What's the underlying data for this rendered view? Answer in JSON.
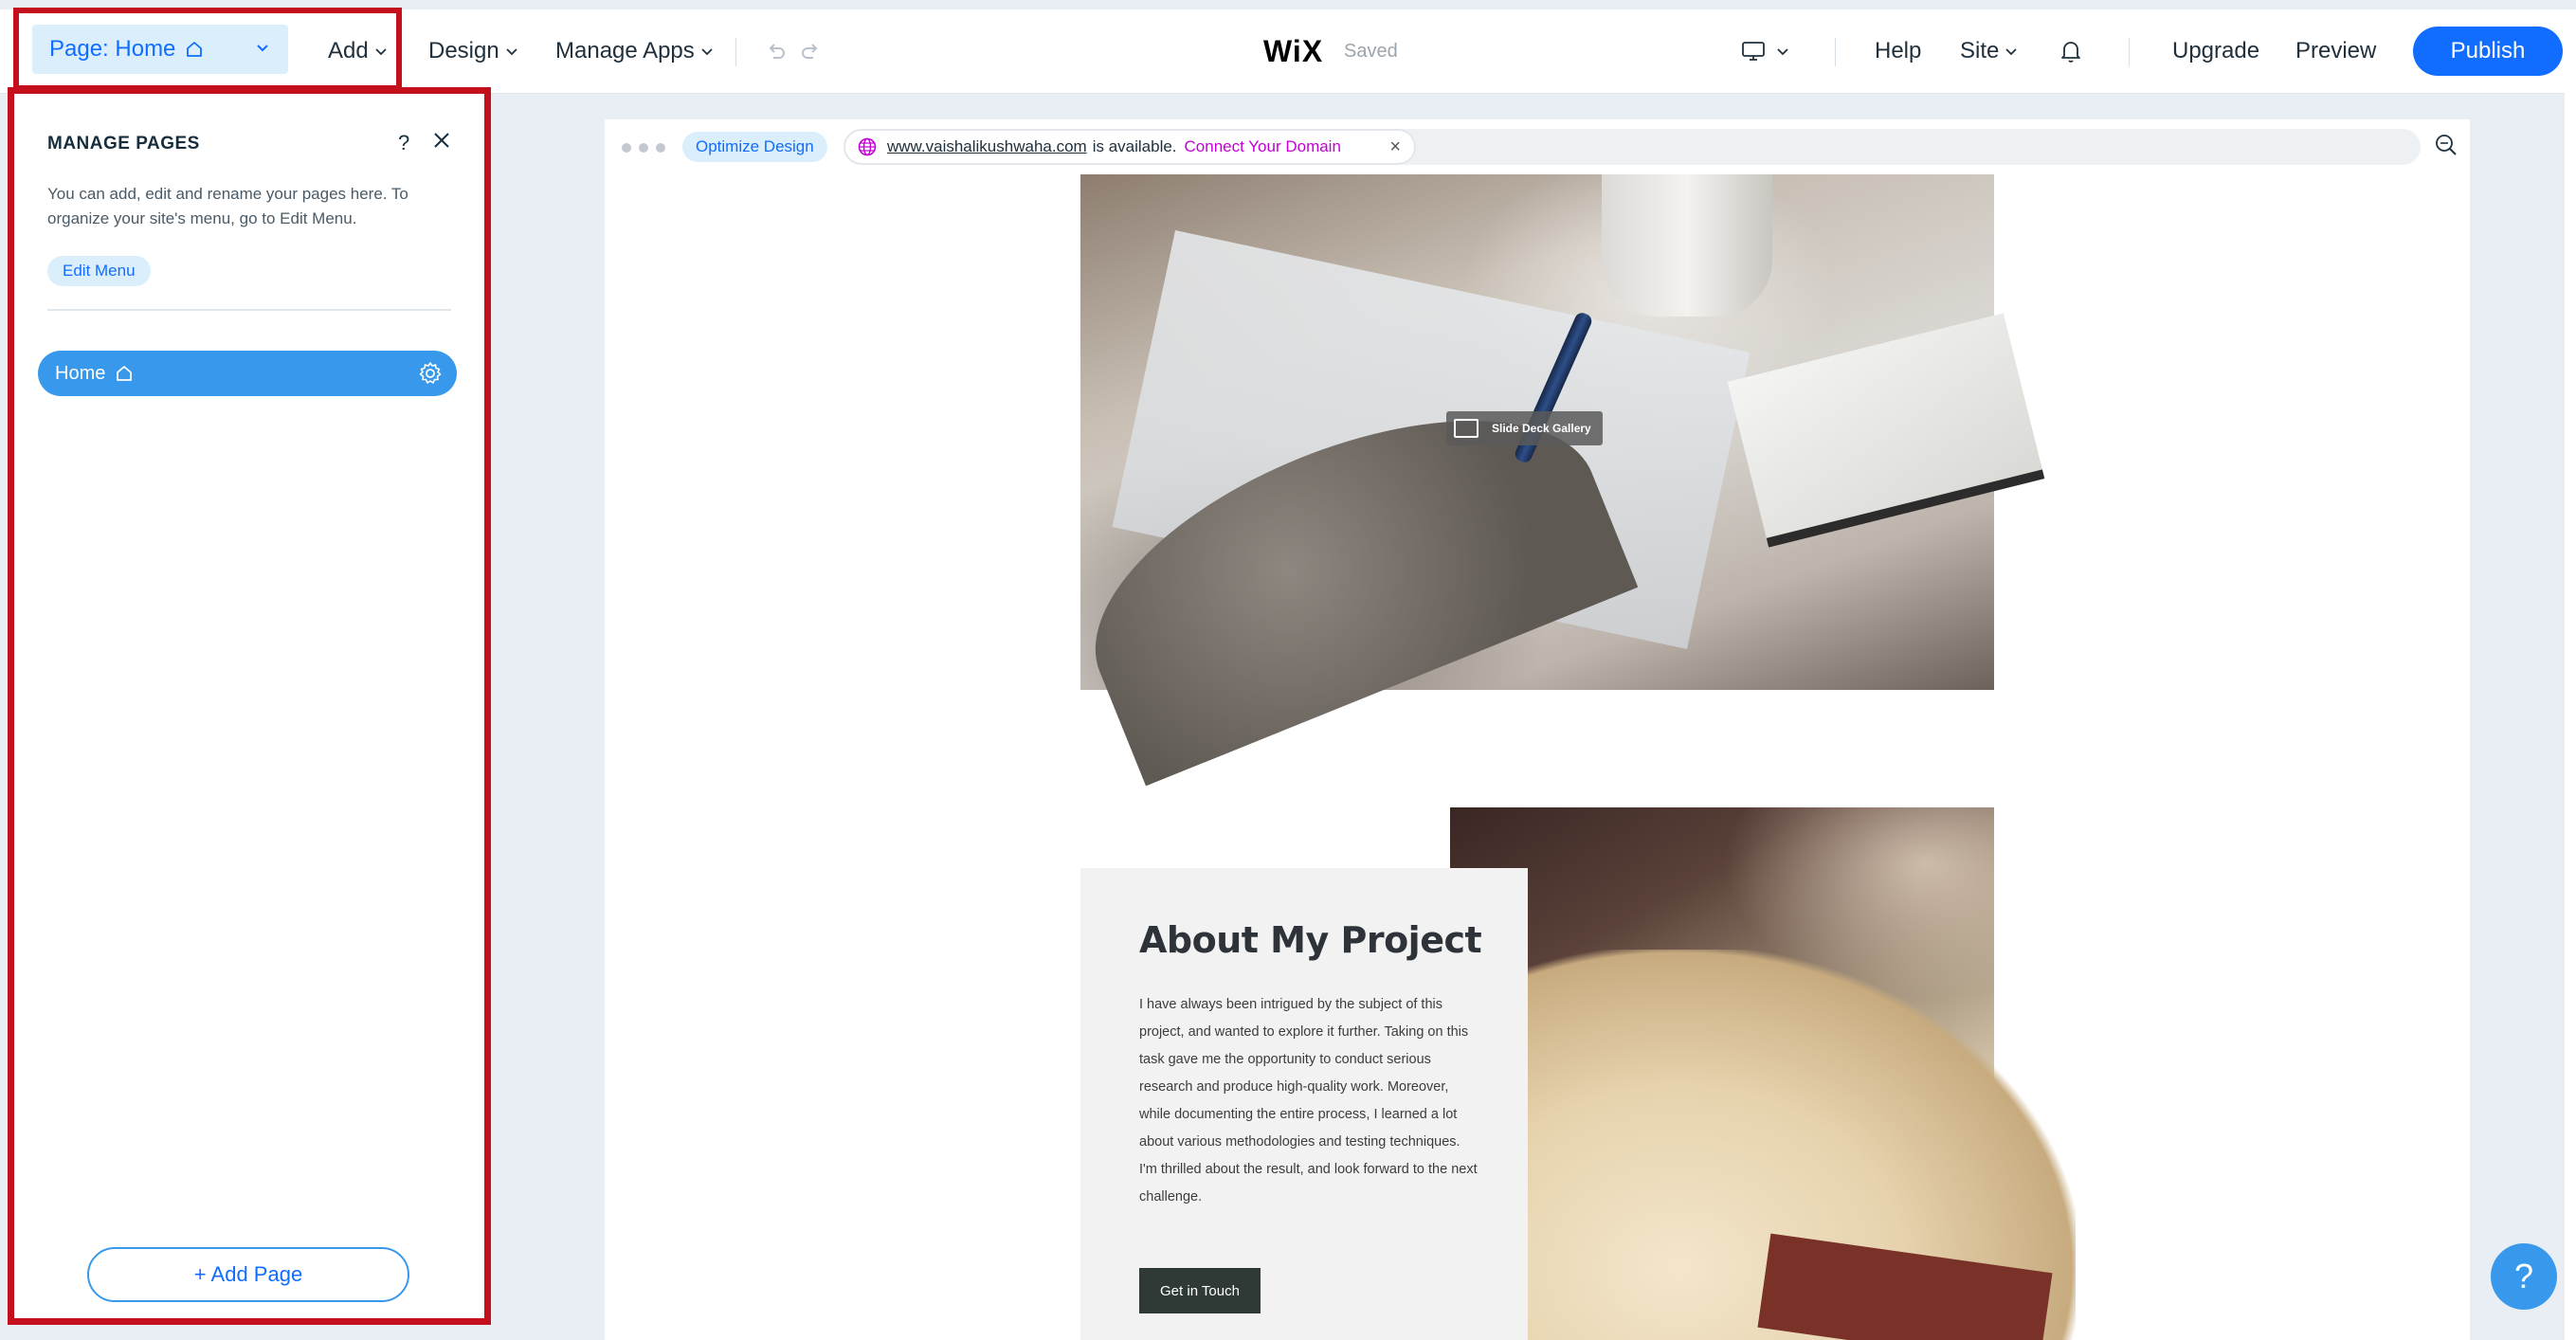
{
  "topbar": {
    "page_selector": "Page: Home",
    "add": "Add",
    "design": "Design",
    "manage_apps": "Manage Apps",
    "logo": "WiX",
    "status": "Saved",
    "help": "Help",
    "site": "Site",
    "upgrade": "Upgrade",
    "preview": "Preview",
    "publish": "Publish",
    "icons": [
      "home-icon",
      "chevron-down-icon",
      "undo-icon",
      "redo-icon",
      "desktop-icon",
      "bell-icon"
    ]
  },
  "panel": {
    "title": "MANAGE PAGES",
    "help": "?",
    "description": "You can add, edit and rename your pages here. To organize your site's menu, go to Edit Menu.",
    "edit_menu": "Edit Menu",
    "pages": [
      {
        "label": "Home",
        "is_home": true,
        "selected": true
      }
    ],
    "add_page": "+ Add Page"
  },
  "canvas": {
    "optimize": "Optimize Design",
    "domain_url": "www.vaishalikushwaha.com",
    "domain_text": "is available.",
    "connect_domain": "Connect Your Domain",
    "gallery_label": "Slide Deck Gallery",
    "about": {
      "title": "About My Project",
      "body": "I have always been intrigued by the subject of this project, and wanted to explore it further. Taking on this task gave me the opportunity to conduct serious research and produce high-quality work. Moreover, while documenting the entire process, I learned a lot about various methodologies and testing techniques. I'm thrilled about the result, and look forward to the next challenge.",
      "button": "Get in Touch"
    }
  },
  "help_fab": "?",
  "colors": {
    "accent": "#116dff",
    "accent_light": "#3899ec",
    "highlight": "#c4101d",
    "connect_domain": "#c300d6"
  }
}
